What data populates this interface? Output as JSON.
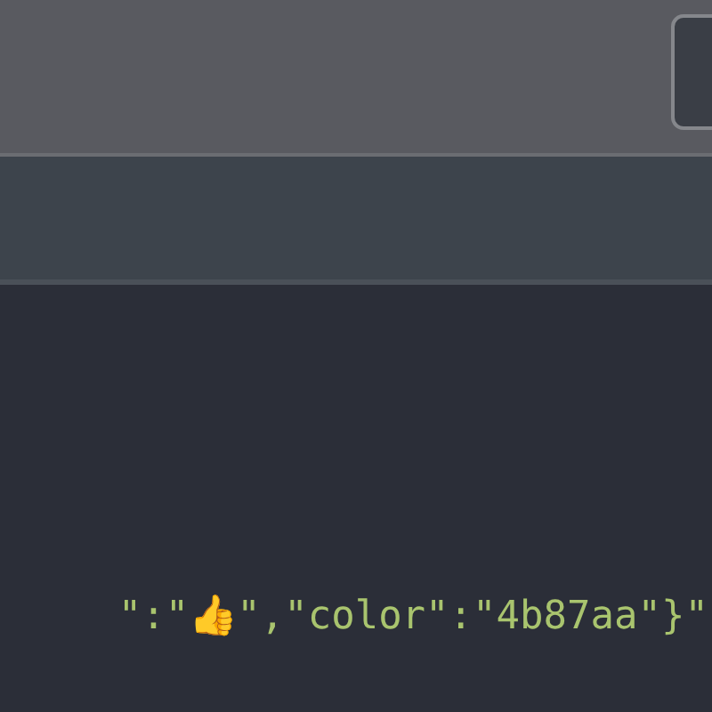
{
  "code_line": "\":\"👍\",\"color\":\"4b87aa\"}\""
}
